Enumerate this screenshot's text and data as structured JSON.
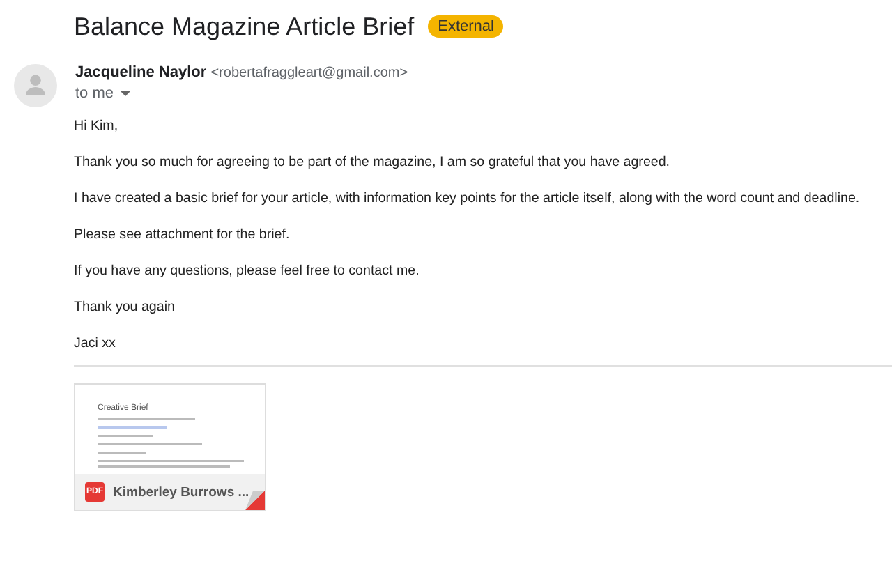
{
  "subject": "Balance Magazine Article Brief",
  "label": {
    "text": "External",
    "color": "#f4b400"
  },
  "sender": {
    "name": "Jacqueline Naylor",
    "email": "<robertafraggleart@gmail.com>",
    "recipient": "to me"
  },
  "body": [
    "Hi Kim,",
    "Thank you so much for agreeing to be part of the magazine, I am so grateful that you have agreed.",
    "I have created a basic brief for your article, with information key points for the article itself, along with the word count and deadline.",
    "Please see attachment for the brief.",
    "If you have any questions, please feel free to contact me.",
    "Thank you again",
    "Jaci xx"
  ],
  "attachment": {
    "preview_title": "Creative Brief",
    "file_type": "PDF",
    "file_name": "Kimberley Burrows ..."
  }
}
